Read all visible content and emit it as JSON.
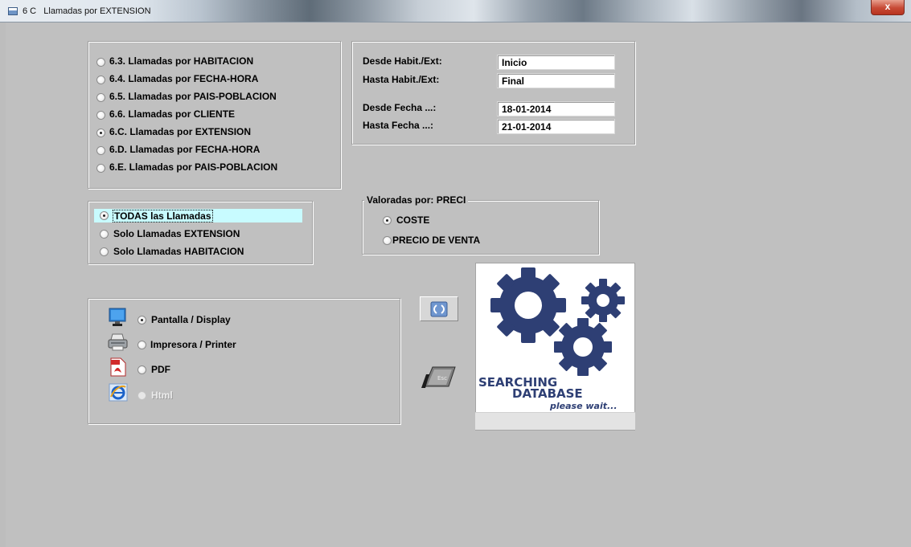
{
  "window": {
    "title": "6 C   Llamadas por EXTENSION",
    "close_glyph": "x"
  },
  "report_options": [
    {
      "label": "6.3.  Llamadas por HABITACION",
      "selected": false
    },
    {
      "label": "6.4.  Llamadas por FECHA-HORA",
      "selected": false
    },
    {
      "label": "6.5.  Llamadas por PAIS-POBLACION",
      "selected": false
    },
    {
      "label": "6.6.  Llamadas por CLIENTE",
      "selected": false
    },
    {
      "label": "6.C.  Llamadas por EXTENSION",
      "selected": true
    },
    {
      "label": "6.D.  Llamadas por FECHA-HORA",
      "selected": false
    },
    {
      "label": "6.E.  Llamadas por PAIS-POBLACION",
      "selected": false
    }
  ],
  "filters": {
    "desde_habit_label": "Desde Habit./Ext:",
    "desde_habit_value": "Inicio",
    "hasta_habit_label": "Hasta Habit./Ext:",
    "hasta_habit_value": "Final",
    "desde_fecha_label": "Desde  Fecha ...:",
    "desde_fecha_value": "18-01-2014",
    "hasta_fecha_label": "Hasta  Fecha ...:",
    "hasta_fecha_value": "21-01-2014"
  },
  "call_type_options": [
    {
      "label": "TODAS las Llamadas",
      "selected": true
    },
    {
      "label": "Solo Llamadas EXTENSION",
      "selected": false
    },
    {
      "label": "Solo Llamadas HABITACION",
      "selected": false
    }
  ],
  "valoradas": {
    "legend": "Valoradas por: PRECI",
    "options": [
      {
        "label": "COSTE",
        "selected": true
      },
      {
        "label": "PRECIO DE VENTA",
        "selected": false
      }
    ]
  },
  "output_options": [
    {
      "label": "Pantalla / Display",
      "selected": true,
      "icon": "monitor-icon",
      "enabled": true
    },
    {
      "label": "Impresora / Printer",
      "selected": false,
      "icon": "printer-icon",
      "enabled": true
    },
    {
      "label": "PDF",
      "selected": false,
      "icon": "pdf-icon",
      "enabled": true
    },
    {
      "label": "Html",
      "selected": false,
      "icon": "internet-explorer-icon",
      "enabled": false
    }
  ],
  "toolbar": {
    "refresh_icon": "refresh-icon",
    "exit_icon": "escape-key-icon"
  },
  "status_panel": {
    "line1": "SEARCHING",
    "line2": "DATABASE",
    "line3": "please wait..."
  },
  "colors": {
    "background": "#c0c0c0",
    "selected_row": "#c8fbff",
    "gear_blue": "#2e3f74"
  }
}
